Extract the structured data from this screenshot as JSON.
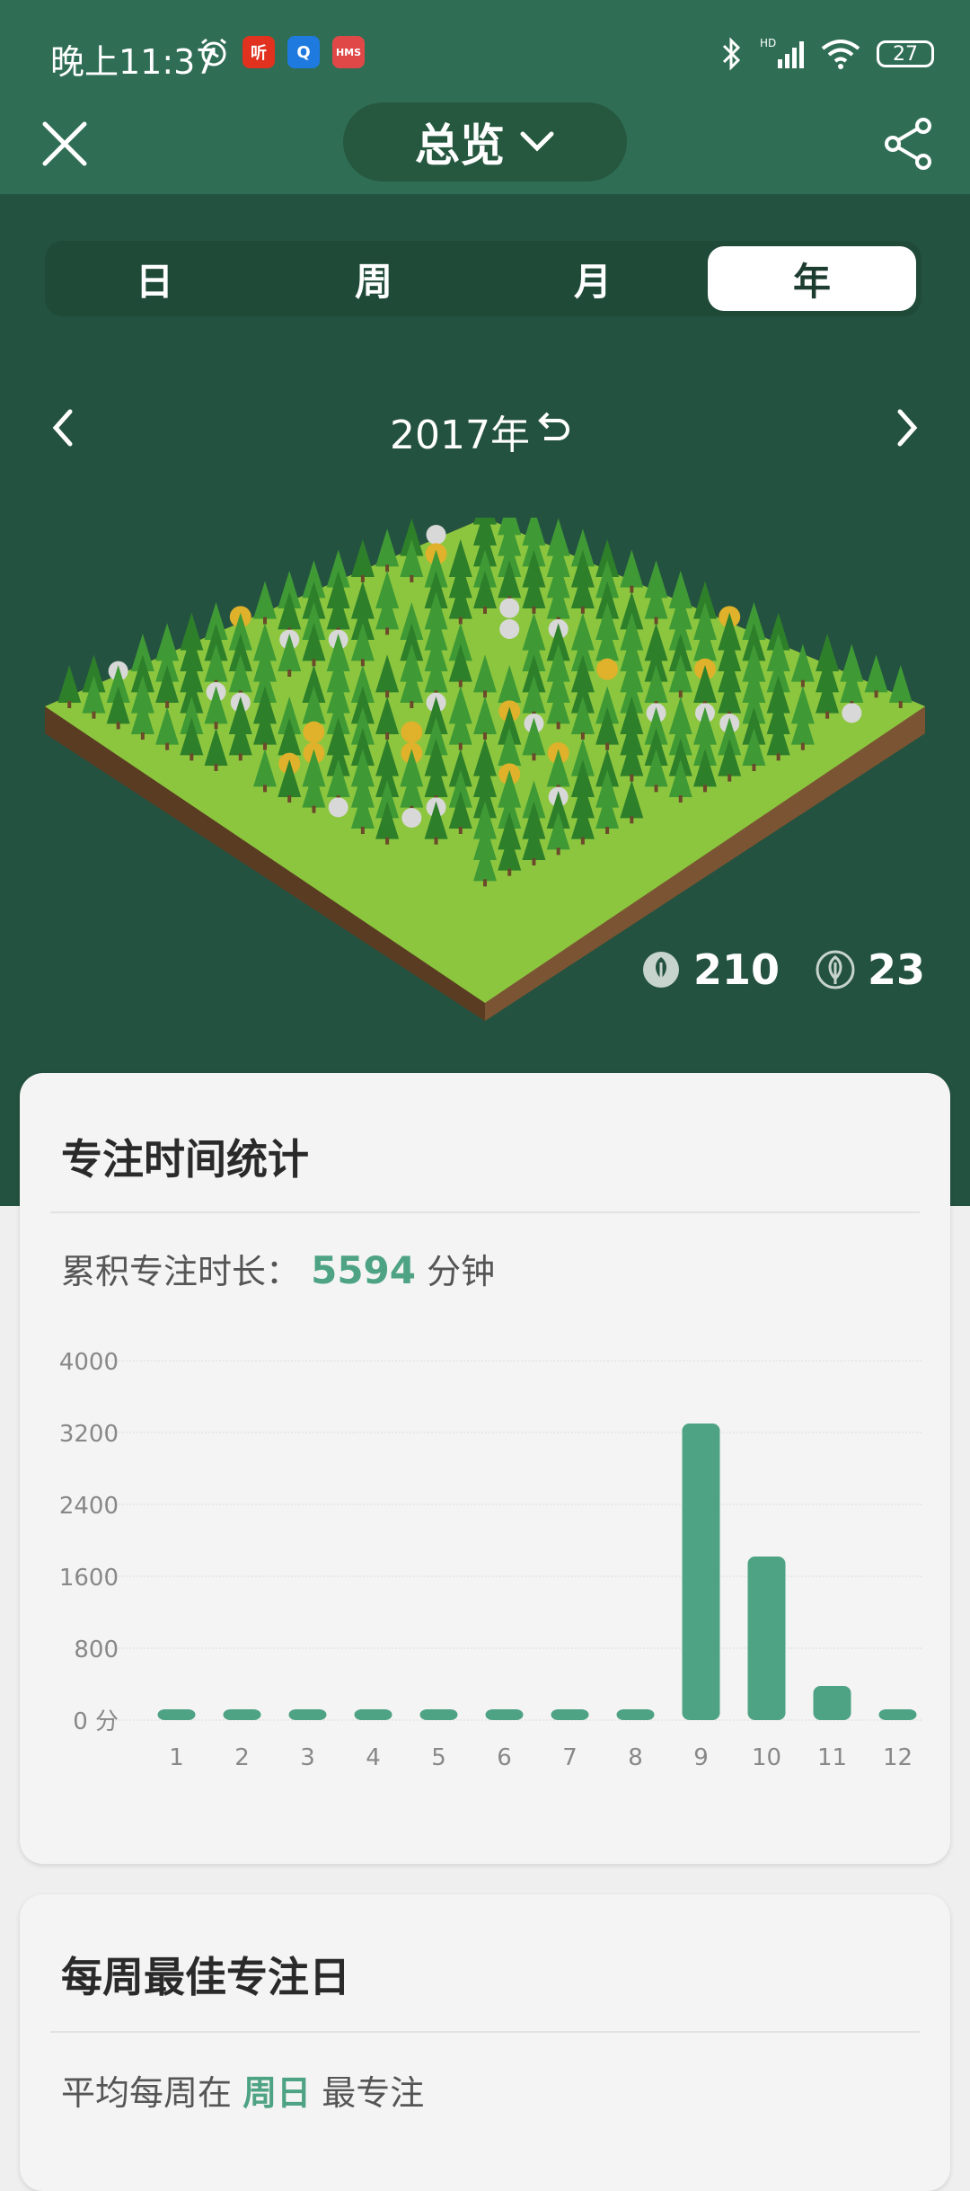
{
  "status_bar": {
    "time": "晚上11:37",
    "app_badges": [
      {
        "label": "听",
        "color": "#e0321e"
      },
      {
        "label": "Q",
        "color": "#1f7ae0"
      },
      {
        "label": "HMS",
        "color": "#e04848"
      }
    ],
    "battery": "27"
  },
  "header": {
    "title": "总览"
  },
  "tabs": [
    {
      "label": "日",
      "active": false
    },
    {
      "label": "周",
      "active": false
    },
    {
      "label": "月",
      "active": false
    },
    {
      "label": "年",
      "active": true
    }
  ],
  "year_nav": {
    "label": "2017年"
  },
  "counts": {
    "healthy_trees": "210",
    "dead_trees": "23"
  },
  "focus_card": {
    "title": "专注时间统计",
    "total_label": "累积专注时长：",
    "total_value": "5594",
    "total_unit": "分钟"
  },
  "chart_data": {
    "type": "bar",
    "categories": [
      "1",
      "2",
      "3",
      "4",
      "5",
      "6",
      "7",
      "8",
      "9",
      "10",
      "11",
      "12"
    ],
    "values": [
      0,
      0,
      0,
      0,
      0,
      0,
      0,
      0,
      3300,
      1820,
      380,
      0
    ],
    "yticks": [
      "0 分",
      "800",
      "1600",
      "2400",
      "3200",
      "4000"
    ],
    "ylim": [
      0,
      4000
    ],
    "bar_color": "#4ea384",
    "grid": true
  },
  "weekly_card": {
    "title": "每周最佳专注日",
    "line_prefix": "平均每周在",
    "line_highlight": "周日",
    "line_suffix": "最专注"
  },
  "colors": {
    "header_bg": "#2f6e55",
    "body_bg": "#245240",
    "accent": "#4ea384"
  }
}
